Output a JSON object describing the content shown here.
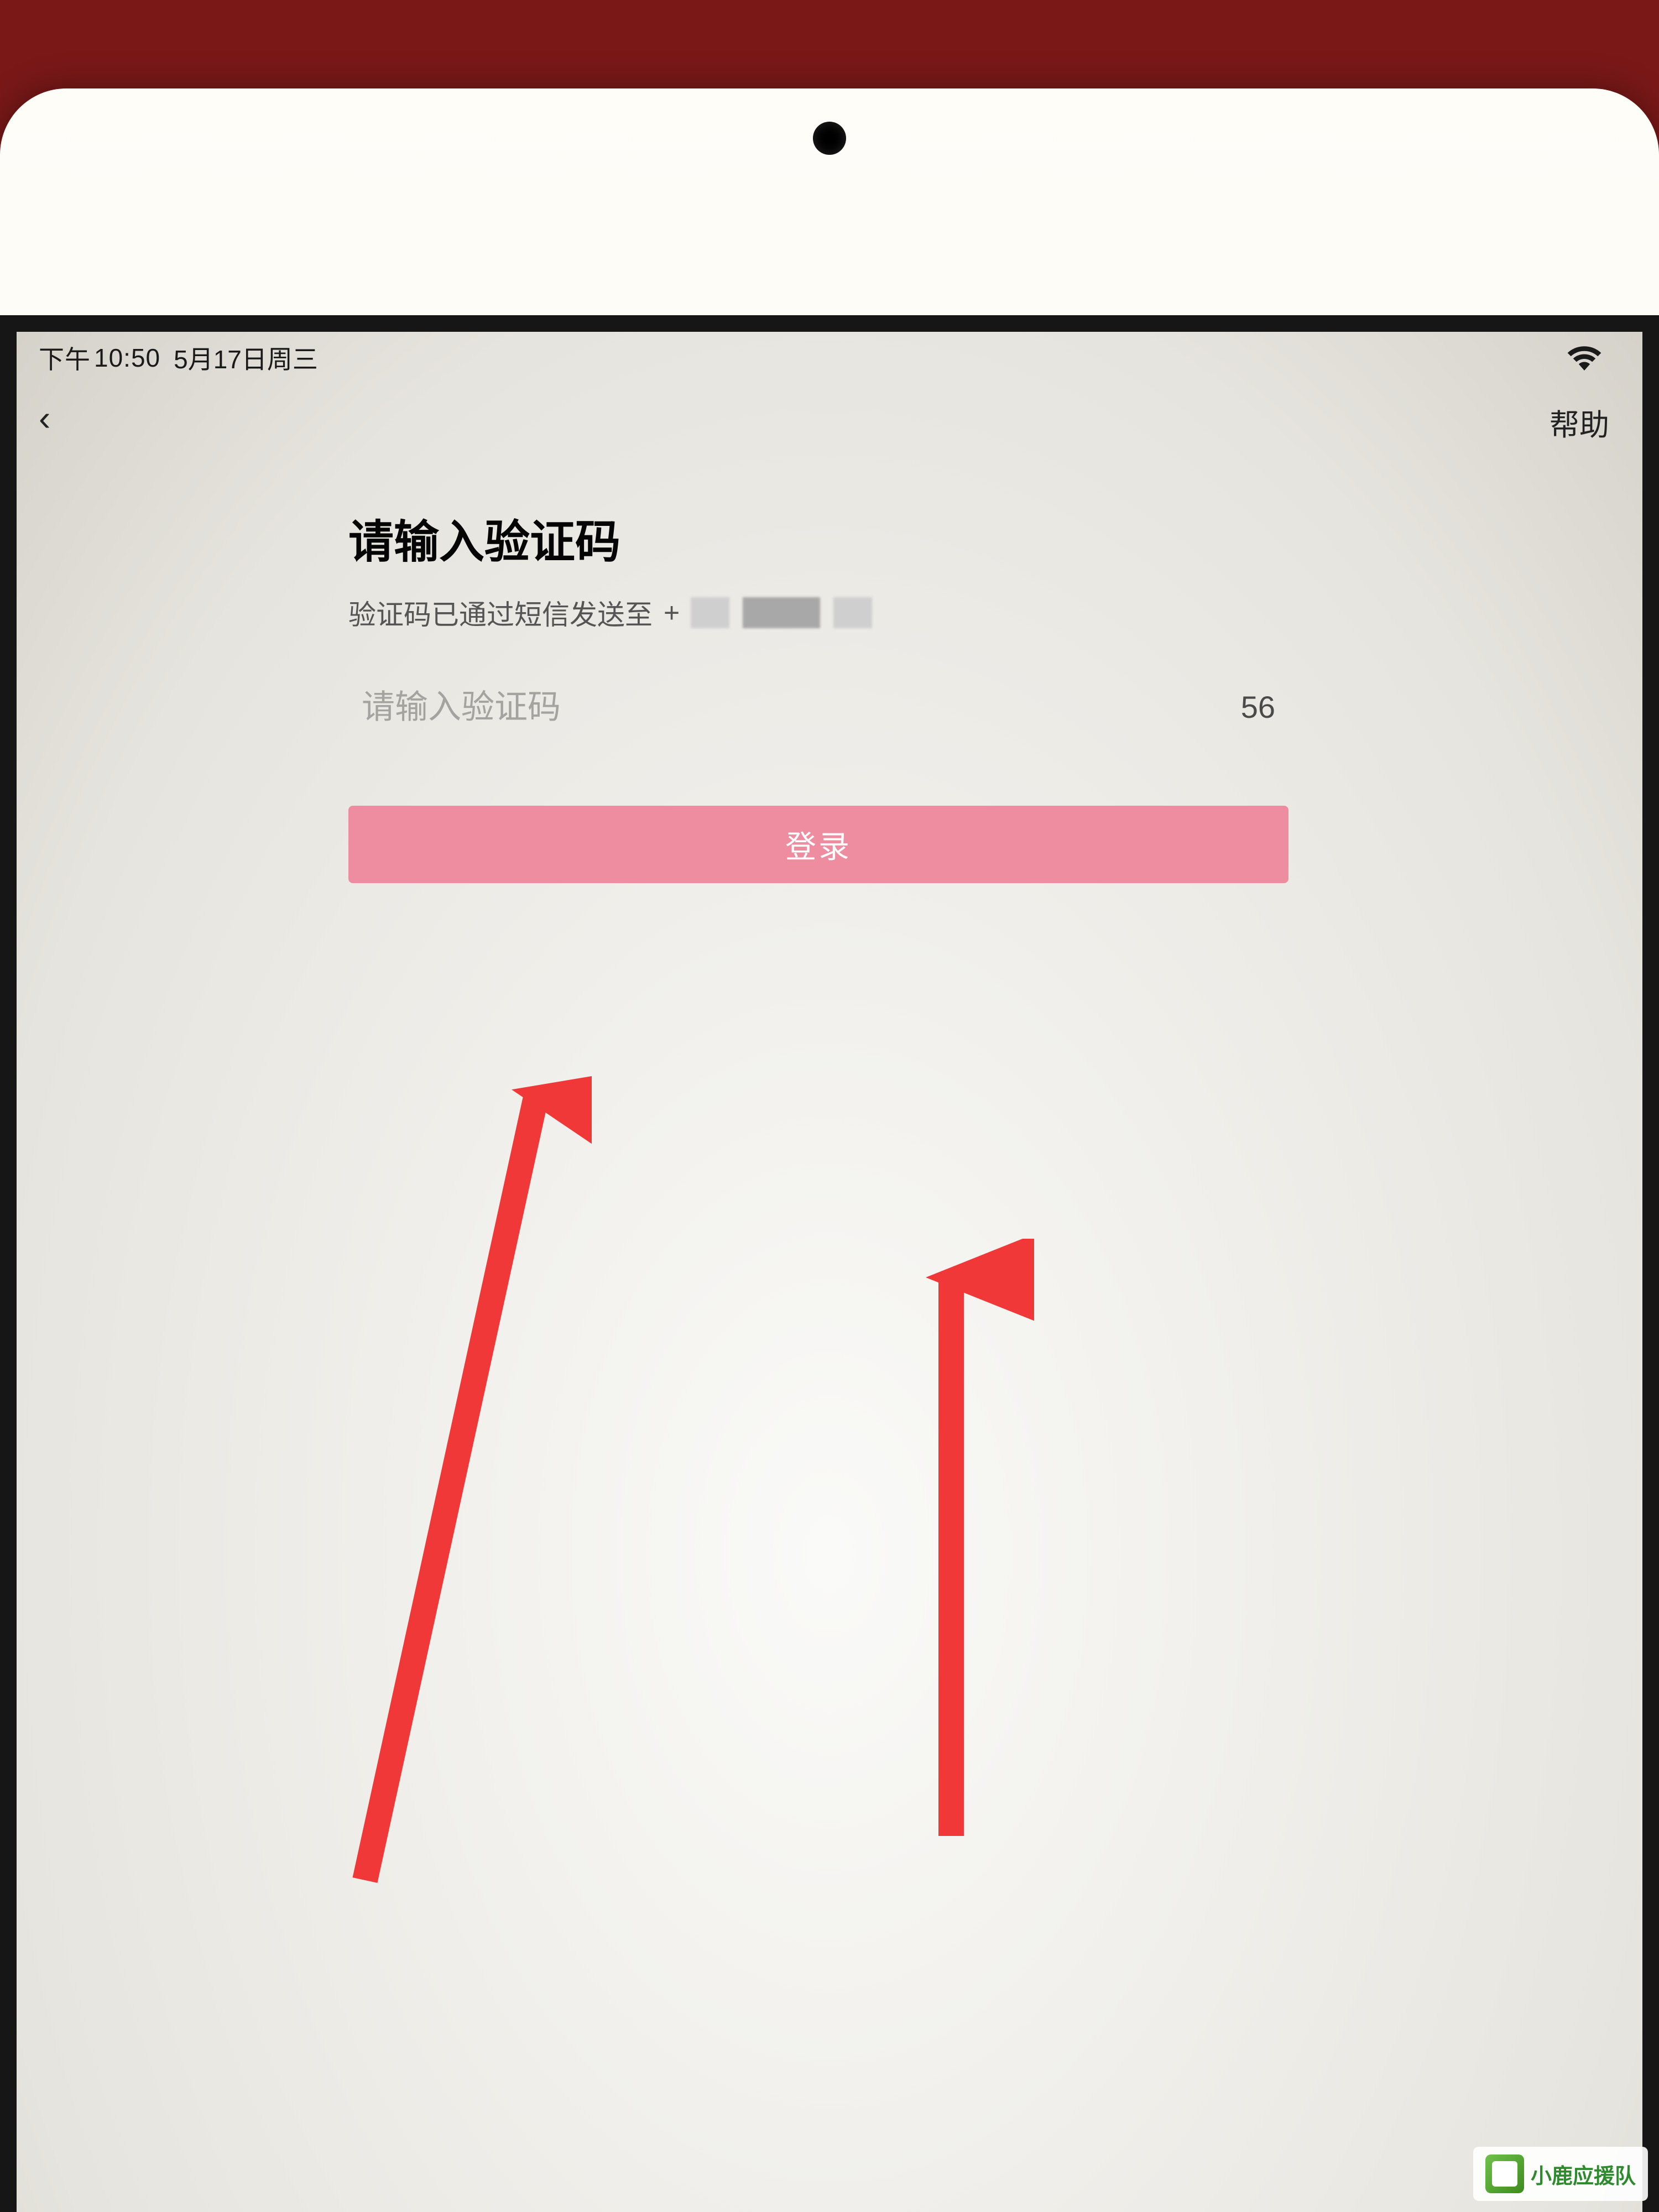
{
  "status_bar": {
    "time_prefix": "下午",
    "time": "10:50",
    "date": "5月17日周三"
  },
  "nav": {
    "back_label": "‹",
    "help_label": "帮助"
  },
  "page": {
    "title": "请输入验证码",
    "subtitle": "验证码已通过短信发送至",
    "phone_prefix": "+"
  },
  "form": {
    "code_placeholder": "请输入验证码",
    "countdown": "56",
    "login_button": "登录"
  },
  "watermark": {
    "text": "小鹿应援队"
  },
  "colors": {
    "login_button_bg": "#ee8ca0",
    "annotation_arrow": "#f03838"
  }
}
